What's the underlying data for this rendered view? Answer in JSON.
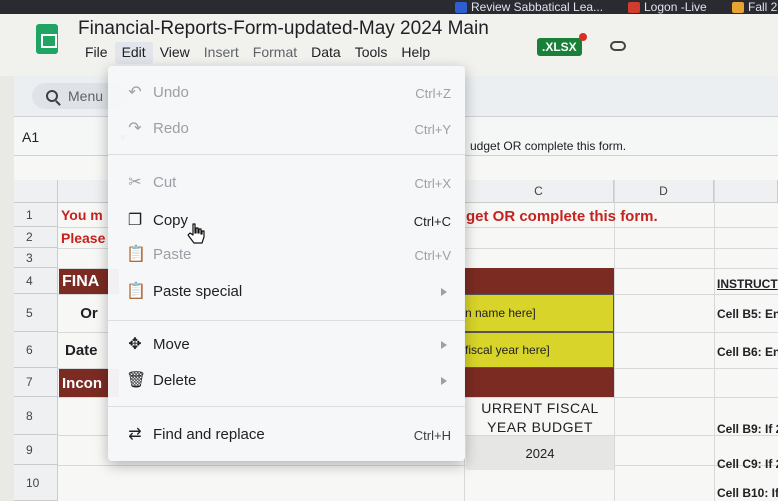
{
  "bookmarks": [
    {
      "label": "Review Sabbatical Lea...",
      "color": "#2d5fd1"
    },
    {
      "label": "Logon -Live",
      "color": "#d33b2f"
    },
    {
      "label": "Fall 2",
      "color": "#e8a431"
    }
  ],
  "doc": {
    "title": "Financial-Reports-Form-updated-May 2024 Main",
    "badge": ".XLSX"
  },
  "menubar": [
    "File",
    "Edit",
    "View",
    "Insert",
    "Format",
    "Data",
    "Tools",
    "Help"
  ],
  "toolbar": {
    "search_label": "Menu"
  },
  "formulabar": {
    "namebox": "A1",
    "content": "udget OR complete this form."
  },
  "grid": {
    "columns": [
      "C",
      "D"
    ],
    "rows": [
      "1",
      "2",
      "3",
      "4",
      "5",
      "6",
      "7",
      "8",
      "9",
      "10"
    ],
    "cells": {
      "a1": "You m",
      "a2": "Please",
      "a4": "FINA",
      "a5": "Or",
      "a6": "Date",
      "a7": "Incon",
      "c2": "get OR complete this form.",
      "c5": "n name here]",
      "c6": "fiscal year here]",
      "c8": "URRENT FISCAL",
      "c9": "YEAR BUDGET",
      "c9b": "2024",
      "e4": "INSTRUCT",
      "e5": "Cell B5: En",
      "e6": "Cell B6: En",
      "e9": "Cell B9: If 2",
      "e10": "Cell C9: If 2",
      "e11": "Cell B10: If"
    }
  },
  "edit_menu": {
    "items": [
      {
        "icon": "undo-icon",
        "glyph": "↶",
        "label": "Undo",
        "shortcut": "Ctrl+Z",
        "disabled": true
      },
      {
        "icon": "redo-icon",
        "glyph": "↷",
        "label": "Redo",
        "shortcut": "Ctrl+Y",
        "disabled": true
      },
      {
        "icon": "cut-icon",
        "glyph": "✂",
        "label": "Cut",
        "shortcut": "Ctrl+X",
        "disabled": true
      },
      {
        "icon": "copy-icon",
        "glyph": "❐",
        "label": "Copy",
        "shortcut": "Ctrl+C",
        "disabled": false
      },
      {
        "icon": "paste-icon",
        "glyph": "📋",
        "label": "Paste",
        "shortcut": "Ctrl+V",
        "disabled": true
      },
      {
        "icon": "paste-special-icon",
        "glyph": "📋",
        "label": "Paste special",
        "shortcut": "",
        "disabled": false
      },
      {
        "icon": "move-icon",
        "glyph": "✥",
        "label": "Move",
        "shortcut": "",
        "disabled": false
      },
      {
        "icon": "delete-icon",
        "glyph": "🗑",
        "label": "Delete",
        "shortcut": "",
        "disabled": false
      },
      {
        "icon": "find-replace-icon",
        "glyph": "⇄",
        "label": "Find and replace",
        "shortcut": "Ctrl+H",
        "disabled": false
      }
    ]
  },
  "colors": {
    "accent_green": "#188038",
    "header_red": "#7b2b22",
    "text_red": "#c5221f",
    "yellow_fill": "#d8d42a"
  }
}
